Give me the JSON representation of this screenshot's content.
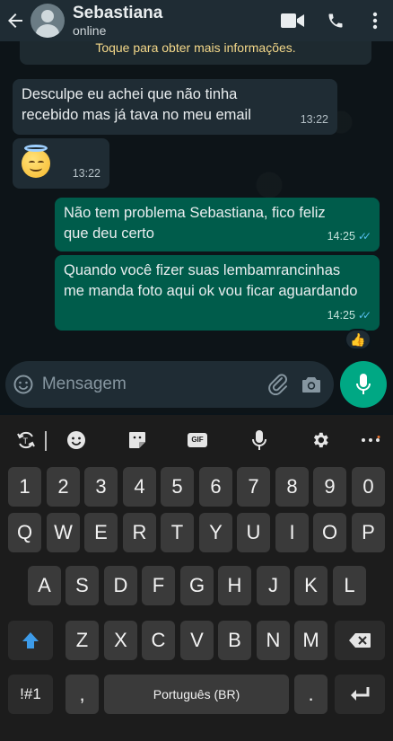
{
  "header": {
    "contact_name": "Sebastiana",
    "status": "online",
    "icons": [
      "back-arrow-icon",
      "video-call-icon",
      "phone-icon",
      "more-vert-icon"
    ]
  },
  "chat": {
    "info_banner": "Toque para obter mais informações.",
    "messages": [
      {
        "direction": "in",
        "text": "Desculpe eu achei que não tinha recebido mas já tava no meu email",
        "time": "13:22"
      },
      {
        "direction": "in",
        "emoji": "smiling-face-with-halo",
        "time": "13:22"
      },
      {
        "direction": "out",
        "text": "Não tem problema Sebastiana, fico feliz que deu certo",
        "time": "14:25",
        "status": "read"
      },
      {
        "direction": "out",
        "text": "Quando você fizer suas lembamrancinhas me manda foto aqui ok vou ficar aguardando",
        "time": "14:25",
        "status": "read",
        "reaction": "👍"
      }
    ]
  },
  "composer": {
    "placeholder": "Mensagem"
  },
  "keyboard": {
    "toolbar": [
      "text-swap-icon",
      "emoji-icon",
      "sticker-icon",
      "GIF",
      "voice-input-icon",
      "settings-icon",
      "more-dots-icon"
    ],
    "row_numbers": [
      "1",
      "2",
      "3",
      "4",
      "5",
      "6",
      "7",
      "8",
      "9",
      "0"
    ],
    "row1": [
      "Q",
      "W",
      "E",
      "R",
      "T",
      "Y",
      "U",
      "I",
      "O",
      "P"
    ],
    "row2": [
      "A",
      "S",
      "D",
      "F",
      "G",
      "H",
      "J",
      "K",
      "L"
    ],
    "row3": [
      "Z",
      "X",
      "C",
      "V",
      "B",
      "N",
      "M"
    ],
    "symbols_key": "!#1",
    "comma_key": ",",
    "space_label": "Português (BR)",
    "period_key": ".",
    "colors": {
      "accent": "#00a884",
      "shift": "#3d9be9"
    }
  }
}
